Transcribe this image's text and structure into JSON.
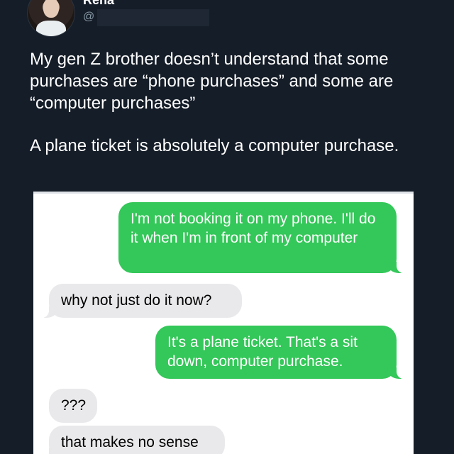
{
  "author": {
    "display_name": "Rena",
    "handle_prefix": "@"
  },
  "tweet": {
    "paragraph_1": "My gen Z brother doesn’t understand that some purchases are “phone purchases” and some are “computer purchases”",
    "paragraph_2": "A plane ticket is absolutely a computer purchase."
  },
  "messages": [
    {
      "direction": "sent",
      "text": "I'm not booking it on my phone. I'll do it when I'm in front of my computer"
    },
    {
      "direction": "received",
      "text": "why not just do it now?"
    },
    {
      "direction": "sent",
      "text": "It's a plane ticket. That's a sit down, computer purchase."
    },
    {
      "direction": "received",
      "text": "???"
    },
    {
      "direction": "received",
      "text": "that makes no sense"
    }
  ],
  "colors": {
    "background": "#151d28",
    "sent_bubble": "#34c759",
    "received_bubble": "#e9e9eb",
    "handle_text": "#8899a6"
  }
}
